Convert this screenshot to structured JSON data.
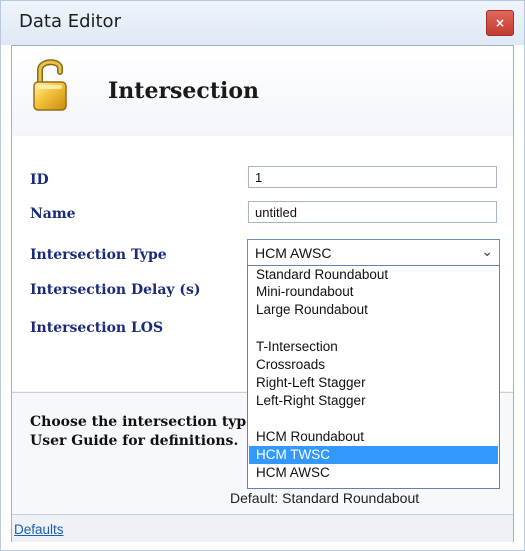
{
  "window": {
    "title": "Data Editor",
    "close_label": "×"
  },
  "header": {
    "heading": "Intersection",
    "icon": "padlock-unlocked-icon"
  },
  "form": {
    "id_label": "ID",
    "id_value": "1",
    "name_label": "Name",
    "name_value": "untitled",
    "type_label": "Intersection Type",
    "type_value": "HCM AWSC",
    "delay_label": "Intersection Delay (s)",
    "los_label": "Intersection LOS"
  },
  "dropdown": {
    "options": [
      "Standard Roundabout",
      "Mini-roundabout",
      "Large Roundabout",
      "",
      "T-Intersection",
      "Crossroads",
      "Right-Left Stagger",
      "Left-Right Stagger",
      "",
      "HCM Roundabout",
      "HCM TWSC",
      "HCM AWSC"
    ],
    "highlighted": "HCM TWSC"
  },
  "description": {
    "line1": "Choose the intersection type. See the",
    "line2": "User Guide for definitions.",
    "default_text": "Default: Standard Roundabout"
  },
  "footer": {
    "defaults_link": "Defaults"
  },
  "colors": {
    "label": "#1c2a7c",
    "highlight": "#3399ff",
    "close_button": "#c23b2f",
    "link": "#1a5fb4"
  }
}
